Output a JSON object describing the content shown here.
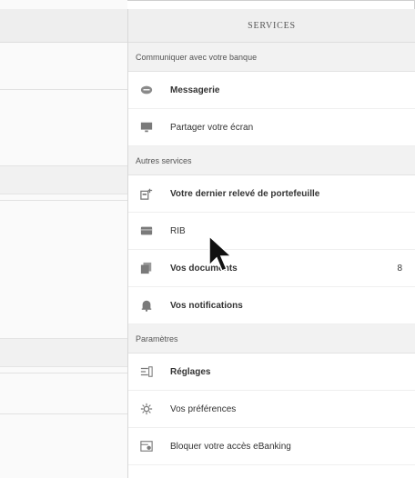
{
  "panel": {
    "title": "SERVICES",
    "sections": [
      {
        "header": "Communiquer avec votre banque",
        "items": [
          {
            "label": "Messagerie",
            "icon": "chat-icon"
          },
          {
            "label": "Partager votre écran",
            "icon": "screen-share-icon"
          }
        ]
      },
      {
        "header": "Autres services",
        "items": [
          {
            "label": "Votre dernier relevé de portefeuille",
            "icon": "portfolio-icon"
          },
          {
            "label": "RIB",
            "icon": "card-icon"
          },
          {
            "label": "Vos documents",
            "icon": "documents-icon",
            "badge": "8"
          },
          {
            "label": "Vos notifications",
            "icon": "bell-icon"
          }
        ]
      },
      {
        "header": "Paramètres",
        "items": [
          {
            "label": "Réglages",
            "icon": "settings-sliders-icon"
          },
          {
            "label": "Vos préférences",
            "icon": "gear-icon"
          },
          {
            "label": "Bloquer votre accès eBanking",
            "icon": "lock-access-icon"
          }
        ]
      }
    ]
  },
  "colors": {
    "panel_header_bg": "#efefef",
    "section_header_bg": "#f2f2f2",
    "icon_gray": "#7a7a7a"
  }
}
